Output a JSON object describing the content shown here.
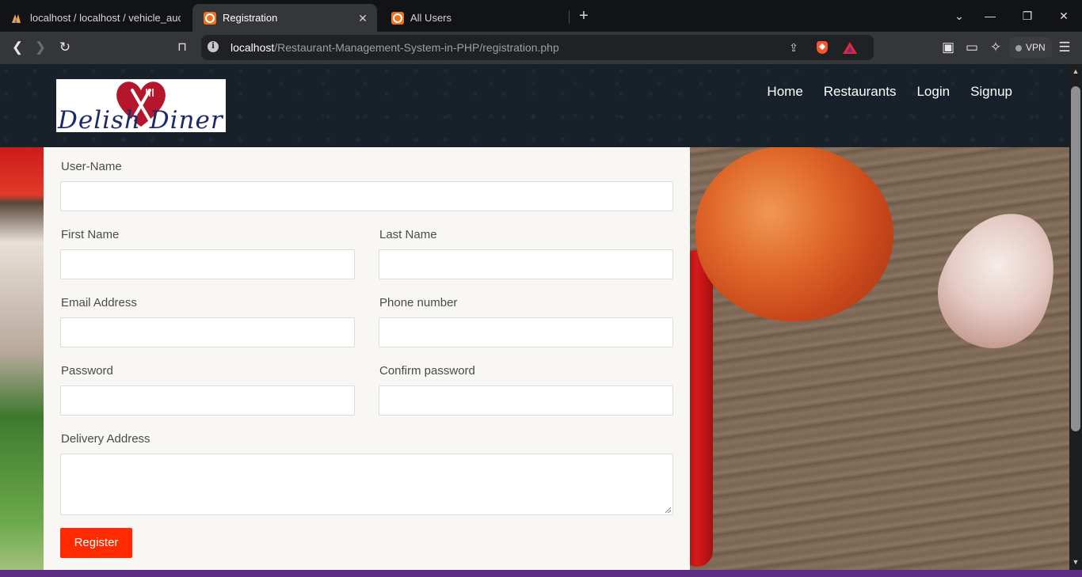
{
  "browser": {
    "tabs": [
      {
        "title": "localhost / localhost / vehicle_auctio"
      },
      {
        "title": "Registration"
      },
      {
        "title": "All Users"
      }
    ],
    "url_host": "localhost",
    "url_path": "/Restaurant-Management-System-in-PHP/registration.php",
    "vpn_label": "VPN"
  },
  "site": {
    "logo_text": "Delish Diner",
    "nav": [
      "Home",
      "Restaurants",
      "Login",
      "Signup"
    ]
  },
  "form": {
    "username_label": "User-Name",
    "firstname_label": "First Name",
    "lastname_label": "Last Name",
    "email_label": "Email Address",
    "phone_label": "Phone number",
    "password_label": "Password",
    "confirm_label": "Confirm password",
    "address_label": "Delivery Address",
    "submit_label": "Register"
  },
  "colors": {
    "header_bg": "#182029",
    "button_bg": "#ff2a00",
    "logo_heart": "#b5162b",
    "logo_text": "#1c2a6b"
  }
}
